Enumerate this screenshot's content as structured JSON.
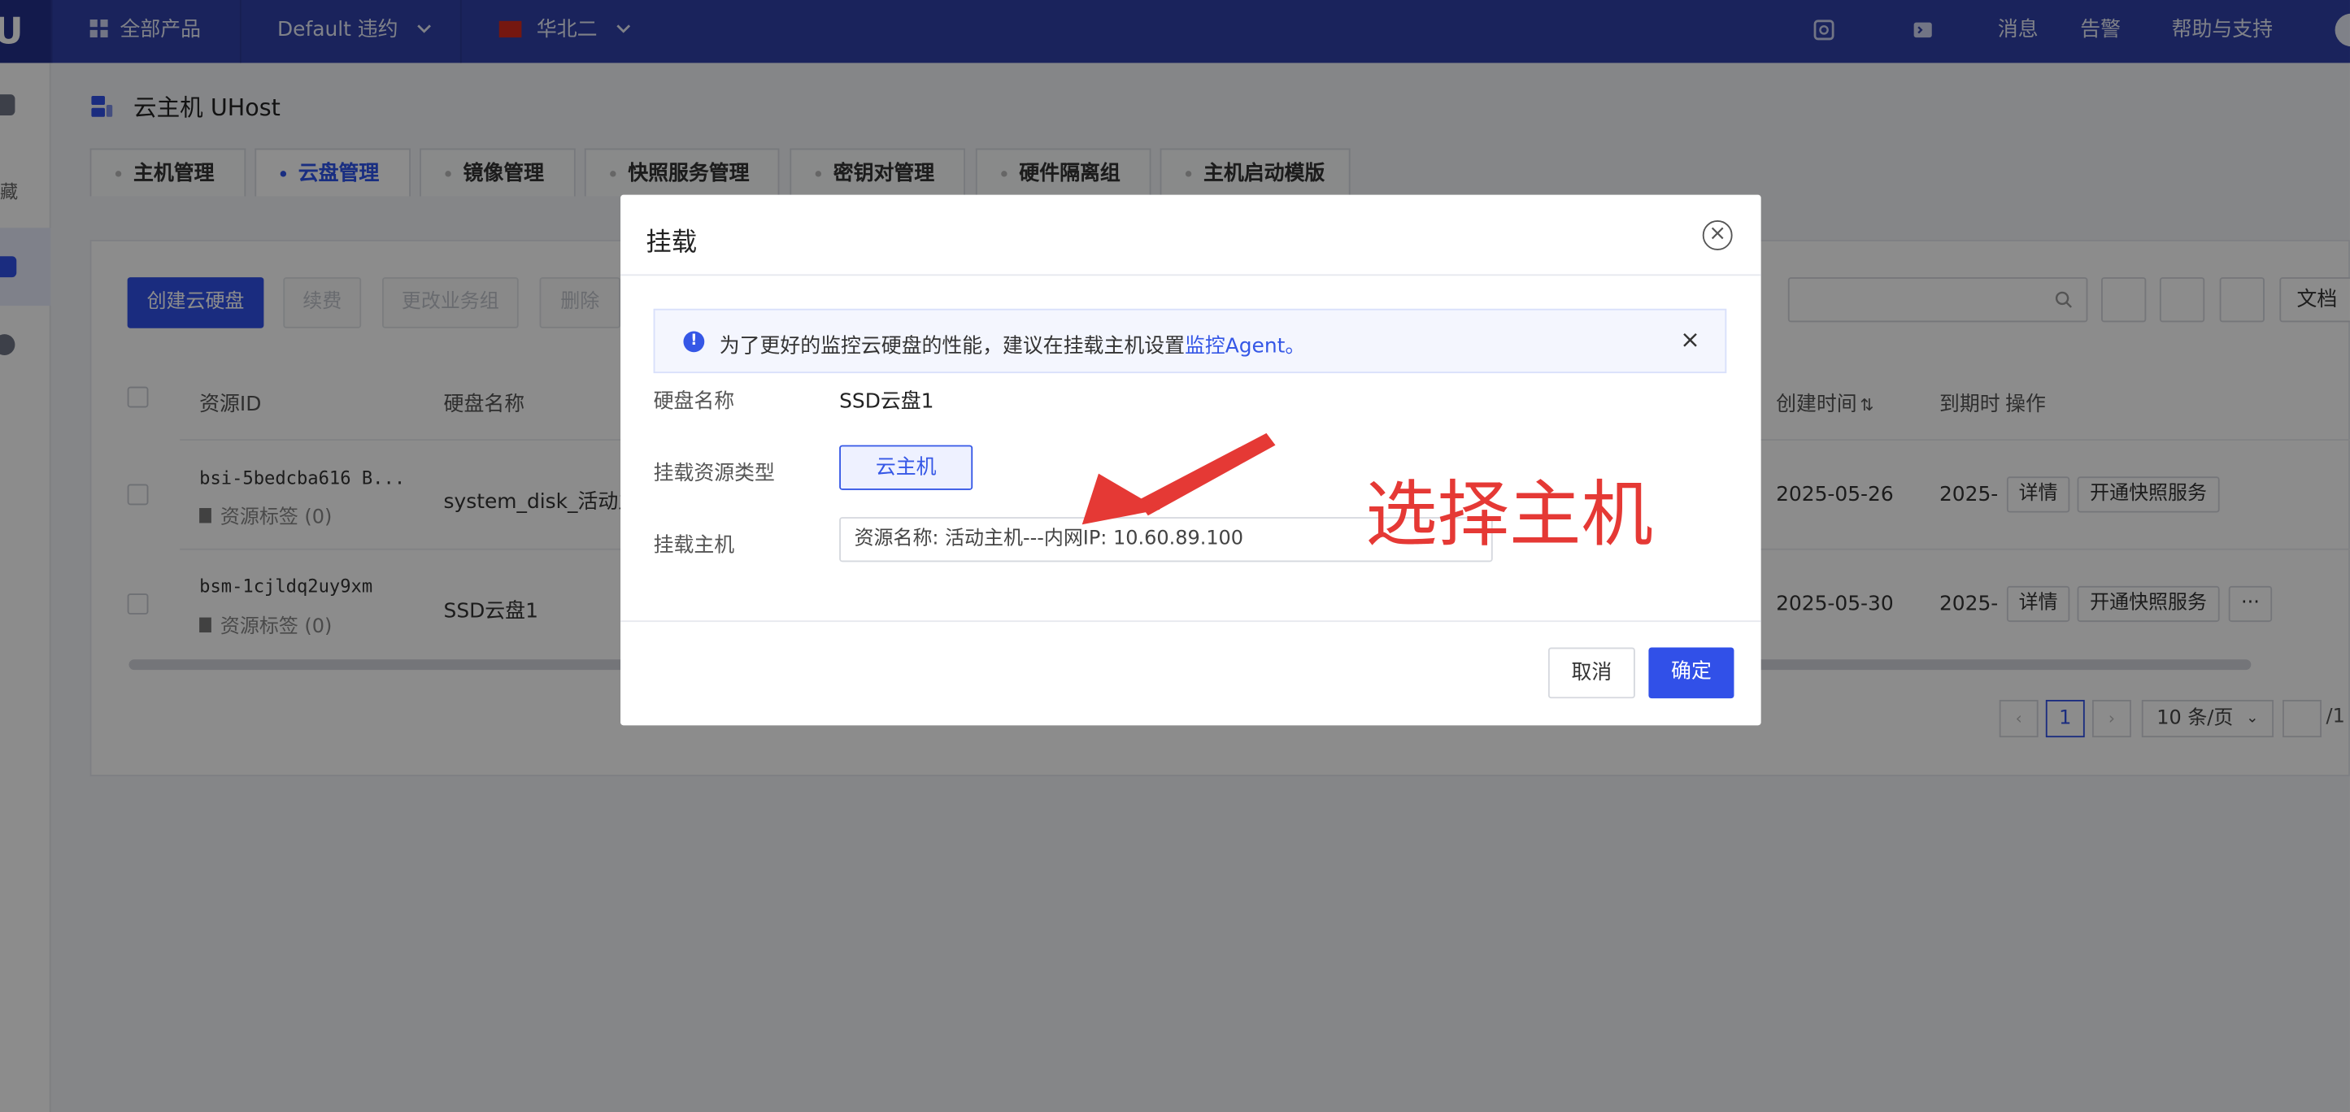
{
  "header": {
    "all_products": "全部产品",
    "project": "Default  违约",
    "region": "华北二",
    "messages": "消息",
    "alerts": "告警",
    "help": "帮助与支持"
  },
  "sidebar": {
    "fav_label": "藏"
  },
  "page": {
    "title": "云主机 UHost",
    "tabs": [
      "主机管理",
      "云盘管理",
      "镜像管理",
      "快照服务管理",
      "密钥对管理",
      "硬件隔离组",
      "主机启动模版"
    ],
    "active_tab": "云盘管理"
  },
  "toolbar": {
    "create": "创建云硬盘",
    "renew": "续费",
    "change_group": "更改业务组",
    "delete": "删除",
    "docs": "文档"
  },
  "table": {
    "headers": {
      "id": "资源ID",
      "name": "硬盘名称",
      "created": "创建时间",
      "expire": "到期时",
      "ops": "操作"
    },
    "rows": [
      {
        "id": "bsi-5bedcba616  B...",
        "tag": "资源标签 (0)",
        "name": "system_disk_活动主机",
        "created": "2025-05-26",
        "expire": "2025-",
        "ops": [
          "详情",
          "开通快照服务"
        ]
      },
      {
        "id": "bsm-1cjldq2uy9xm",
        "tag": "资源标签 (0)",
        "name": "SSD云盘1",
        "created": "2025-05-30",
        "expire": "2025-",
        "ops": [
          "详情",
          "开通快照服务",
          "···"
        ]
      }
    ]
  },
  "pagination": {
    "page": "1",
    "page_size": "10 条/页",
    "total": "/1"
  },
  "modal": {
    "title": "挂载",
    "notice": "为了更好的监控云硬盘的性能，建议在挂载主机设置",
    "notice_link": "监控Agent",
    "notice_end": "。",
    "fields": {
      "disk_name_label": "硬盘名称",
      "disk_name_value": "SSD云盘1",
      "resource_type_label": "挂载资源类型",
      "resource_type_value": "云主机",
      "host_label": "挂载主机",
      "host_value": "资源名称: 活动主机---内网IP: 10.60.89.100"
    },
    "cancel": "取消",
    "confirm": "确定"
  },
  "annotation": {
    "text": "选择主机",
    "color": "#e53935"
  },
  "colors": {
    "topbar": "#3041a8",
    "primary": "#3150e8",
    "annotation": "#e53935"
  }
}
